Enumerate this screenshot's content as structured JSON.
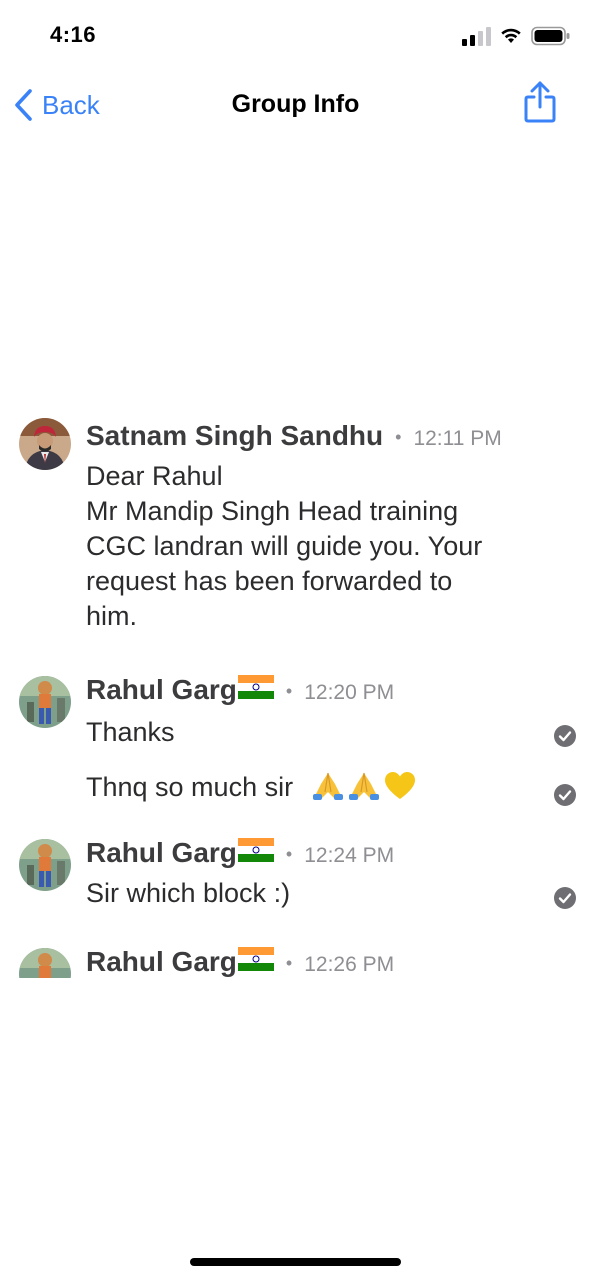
{
  "status_bar": {
    "time": "4:16",
    "icons": [
      "signal-icon",
      "wifi-icon",
      "battery-icon"
    ]
  },
  "nav": {
    "back_label": "Back",
    "title": "Group Info",
    "share_icon": "share-icon"
  },
  "messages": [
    {
      "sender": "Satnam Singh Sandhu",
      "time": "12:11 PM",
      "texts": [
        "Dear Rahul\nMr Mandip Singh Head training\nCGC landran will guide you. Your\nrequest has been forwarded to\nhim."
      ],
      "read": false
    },
    {
      "sender": "Rahul Garg",
      "time": "12:20 PM",
      "texts": [
        "Thanks",
        "Thnq so much sir"
      ],
      "emoji": [
        "folded-hands-icon",
        "folded-hands-icon",
        "yellow-heart-icon"
      ],
      "read": true
    },
    {
      "sender": "Rahul Garg",
      "time": "12:24 PM",
      "texts": [
        "Sir which block :)"
      ],
      "read": true
    },
    {
      "sender": "Rahul Garg",
      "time": "12:26 PM",
      "texts": [],
      "read": false
    }
  ],
  "colors": {
    "accent": "#3a82f7",
    "text": "#2c2c2e",
    "muted": "#8e8e93",
    "check": "#6e6e73"
  }
}
